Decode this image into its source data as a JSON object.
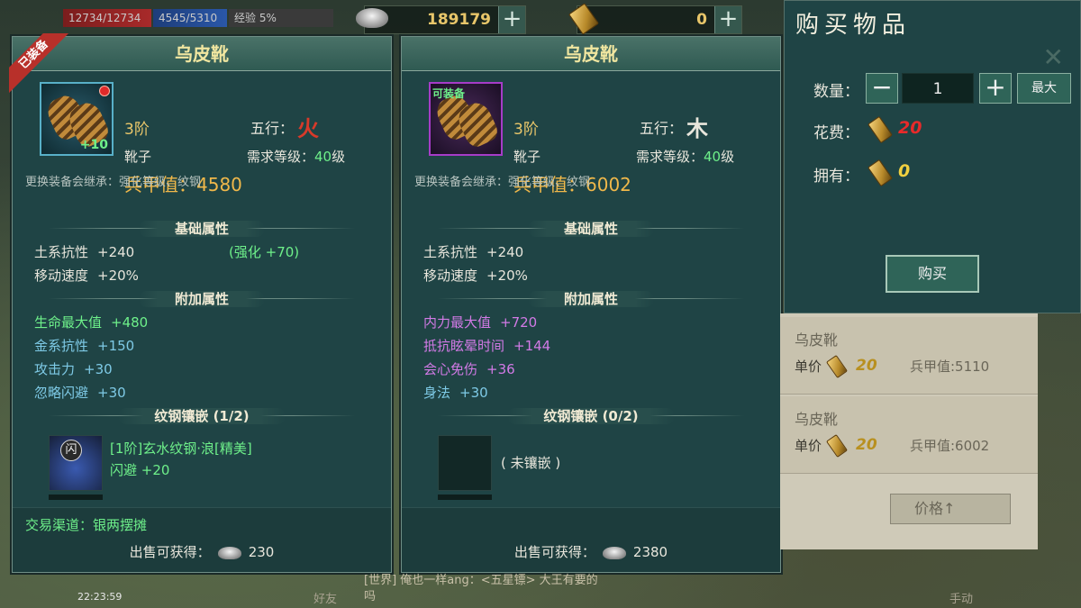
{
  "hud": {
    "hp": "12734/12734",
    "mp": "4545/5310",
    "exp": "经验 5%",
    "silver": "189179",
    "gold": "0",
    "plus": "+"
  },
  "left": {
    "equipped_badge": "已装备",
    "title": "乌皮靴",
    "icon_plus": "+10",
    "tier": "3阶",
    "wuxing_label": "五行：",
    "wuxing_glyph": "火",
    "type": "靴子",
    "req_label": "需求等级：",
    "req_level": "40",
    "req_suffix": "级",
    "armor": "兵甲值：4580",
    "inherit_note": "更换装备会继承：强化等级、纹钢",
    "base_title": "基础属性",
    "base_attrs": [
      {
        "name": "土系抗性",
        "val": "+240",
        "extra": "(强化 +70)"
      },
      {
        "name": "移动速度",
        "val": "+20%",
        "extra": ""
      }
    ],
    "bonus_title": "附加属性",
    "bonus_attrs": [
      {
        "name": "生命最大值",
        "val": "+480"
      },
      {
        "name": "金系抗性",
        "val": "+150"
      },
      {
        "name": "攻击力",
        "val": "+30"
      },
      {
        "name": "忽略闪避",
        "val": "+30"
      }
    ],
    "gem_title": "纹钢镶嵌 (1/2)",
    "gem_badge": "闪",
    "gem_name": "[1阶]玄水纹钢·浪[精美]",
    "gem_stat": "闪避   +20",
    "trade": "交易渠道：银两摆摊",
    "sale_label": "出售可获得：",
    "sale_value": "230"
  },
  "right": {
    "title": "乌皮靴",
    "equipable_badge": "可装备",
    "tier": "3阶",
    "wuxing_label": "五行：",
    "wuxing_glyph": "木",
    "type": "靴子",
    "req_label": "需求等级：",
    "req_level": "40",
    "req_suffix": "级",
    "armor": "兵甲值：6002",
    "inherit_note": "更换装备会继承：强化等级、纹钢",
    "base_title": "基础属性",
    "base_attrs": [
      {
        "name": "土系抗性",
        "val": "+240"
      },
      {
        "name": "移动速度",
        "val": "+20%"
      }
    ],
    "bonus_title": "附加属性",
    "bonus_attrs": [
      {
        "name": "内力最大值",
        "val": "+720"
      },
      {
        "name": "抵抗眩晕时间",
        "val": "+144"
      },
      {
        "name": "会心免伤",
        "val": "+36"
      },
      {
        "name": "身法",
        "val": "+30"
      }
    ],
    "gem_title": "纹钢镶嵌 (0/2)",
    "gem_empty": "( 未镶嵌 )",
    "sale_label": "出售可获得：",
    "sale_value": "2380"
  },
  "buy": {
    "title": "购买物品",
    "qty_label": "数量：",
    "minus": "−",
    "qty": "1",
    "plus": "+",
    "max": "最大",
    "cost_label": "花费：",
    "cost": "20",
    "own_label": "拥有：",
    "own": "0",
    "buy_button": "购买"
  },
  "shop": {
    "items": [
      {
        "name": "乌皮靴",
        "unit_label": "单价",
        "unit_price": "20",
        "armor": "兵甲值:5110"
      },
      {
        "name": "乌皮靴",
        "unit_label": "单价",
        "unit_price": "20",
        "armor": "兵甲值:6002"
      }
    ],
    "sort_label": "价格↑"
  },
  "bottom": {
    "chat": "[世界] 俺也一样ang：<五星镖> 大王有要的",
    "chat2": "吗",
    "friend": "好友",
    "clock": "22:23:59",
    "manual": "手动"
  },
  "colors": {
    "panel_bg": "#1f4445",
    "gold_text": "#e8c66a",
    "green": "#6ef08a",
    "blue": "#7ecae6",
    "purple": "#d27ae6",
    "fire": "#d83a2a",
    "wood": "#e8e6dc"
  }
}
